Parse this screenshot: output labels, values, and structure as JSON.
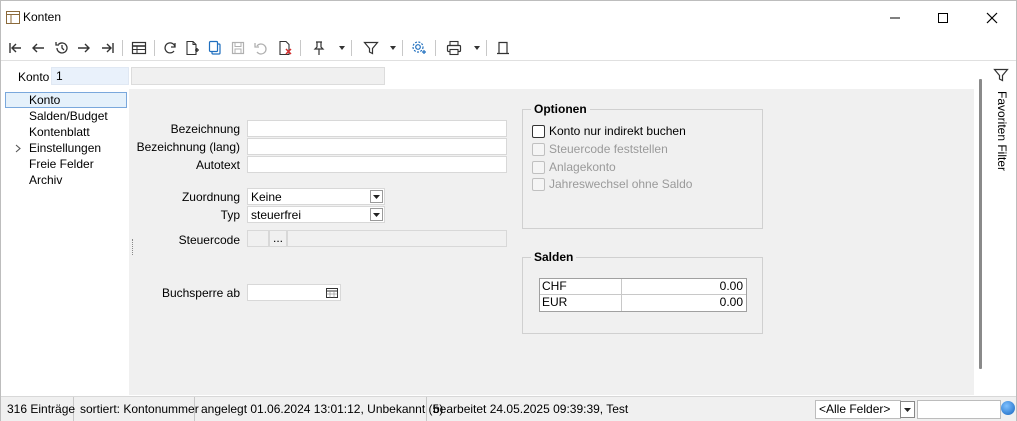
{
  "window": {
    "title": "Konten"
  },
  "header": {
    "konto_label": "Konto",
    "konto_value": "1",
    "konto_name": ""
  },
  "nav": {
    "items": [
      {
        "label": "Konto",
        "selected": true
      },
      {
        "label": "Salden/Budget"
      },
      {
        "label": "Kontenblatt"
      },
      {
        "label": "Einstellungen",
        "expandable": true
      },
      {
        "label": "Freie Felder"
      },
      {
        "label": "Archiv"
      }
    ]
  },
  "form": {
    "bezeichnung_label": "Bezeichnung",
    "bezeichnung_value": "",
    "bezeichnung_lang_label": "Bezeichnung (lang)",
    "bezeichnung_lang_value": "",
    "autotext_label": "Autotext",
    "autotext_value": "",
    "zuordnung_label": "Zuordnung",
    "zuordnung_value": "Keine",
    "typ_label": "Typ",
    "typ_value": "steuerfrei",
    "steuercode_label": "Steuercode",
    "steuercode_btn": "...",
    "buchsperre_label": "Buchsperre ab",
    "buchsperre_value": ""
  },
  "optionen": {
    "title": "Optionen",
    "checks": [
      {
        "label": "Konto nur indirekt buchen",
        "checked": false,
        "enabled": true
      },
      {
        "label": "Steuercode feststellen",
        "checked": false,
        "enabled": false
      },
      {
        "label": "Anlagekonto",
        "checked": false,
        "enabled": false
      },
      {
        "label": "Jahreswechsel ohne Saldo",
        "checked": false,
        "enabled": false
      }
    ]
  },
  "salden": {
    "title": "Salden",
    "rows": [
      {
        "currency": "CHF",
        "value": "0.00"
      },
      {
        "currency": "EUR",
        "value": "0.00"
      }
    ]
  },
  "side_panel": {
    "label": "Favoriten Filter"
  },
  "statusbar": {
    "entries": "316 Einträge",
    "sorted": "sortiert: Kontonummer",
    "created": "angelegt 01.06.2024 13:01:12, Unbekannt (5)",
    "edited": "bearbeitet 24.05.2025 09:39:39, Test",
    "field_select": "<Alle Felder>",
    "search_value": ""
  },
  "colors": {
    "accent": "#1565c0",
    "selection": "#e5f1fb",
    "pane": "#f0f0f0"
  },
  "toolbar_icons": [
    "first-icon",
    "prev-icon",
    "history-icon",
    "next-icon",
    "last-icon",
    "table-icon",
    "refresh-icon",
    "new-doc-icon",
    "copy-icon",
    "save-icon",
    "undo-icon",
    "delete-icon",
    "pin-icon",
    "filter-icon",
    "settings-icon",
    "print-icon",
    "layout-icon"
  ]
}
